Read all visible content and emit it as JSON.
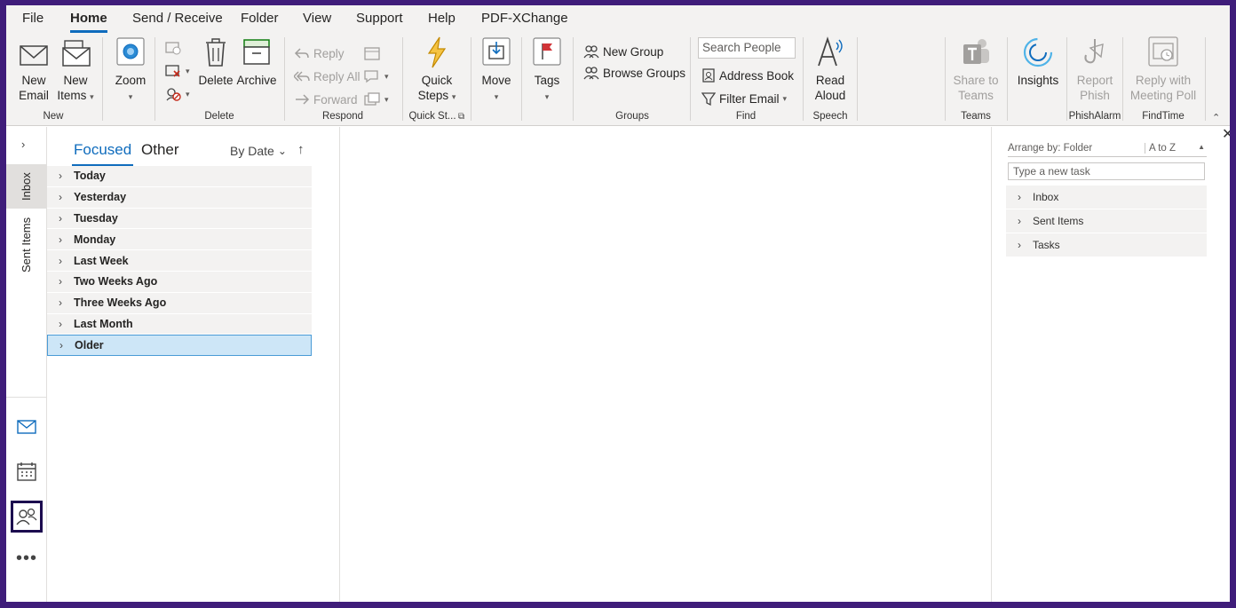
{
  "menu": [
    "File",
    "Home",
    "Send / Receive",
    "Folder",
    "View",
    "Support",
    "Help",
    "PDF-XChange"
  ],
  "active_menu": "Home",
  "ribbon": {
    "new_email": [
      "New",
      "Email"
    ],
    "new_items": [
      "New",
      "Items"
    ],
    "zoom": "Zoom",
    "delete": "Delete",
    "archive": "Archive",
    "reply": "Reply",
    "reply_all": "Reply All",
    "forward": "Forward",
    "quick_steps": [
      "Quick",
      "Steps"
    ],
    "move": "Move",
    "tags": "Tags",
    "new_group": "New Group",
    "browse_groups": "Browse Groups",
    "search_people": "Search People",
    "address_book": "Address Book",
    "filter_email": "Filter Email",
    "read_aloud": [
      "Read",
      "Aloud"
    ],
    "share_to_teams": [
      "Share to",
      "Teams"
    ],
    "insights": "Insights",
    "report_phish": [
      "Report",
      "Phish"
    ],
    "reply_with_poll": [
      "Reply with",
      "Meeting Poll"
    ],
    "groups": {
      "new": "New",
      "delete": "Delete",
      "respond": "Respond",
      "quick_steps": "Quick St...",
      "groups": "Groups",
      "find": "Find",
      "speech": "Speech",
      "teams": "Teams",
      "phishalarm": "PhishAlarm",
      "findtime": "FindTime"
    }
  },
  "rail": {
    "tabs": [
      "Inbox",
      "Sent Items"
    ]
  },
  "list": {
    "tab_focused": "Focused",
    "tab_other": "Other",
    "sort": "By Date",
    "groups": [
      "Today",
      "Yesterday",
      "Tuesday",
      "Monday",
      "Last Week",
      "Two Weeks Ago",
      "Three Weeks Ago",
      "Last Month",
      "Older"
    ],
    "selected": "Older"
  },
  "todo": {
    "arrange_by": "Arrange by: Folder",
    "order": "A to Z",
    "new_task_placeholder": "Type a new task",
    "folders": [
      "Inbox",
      "Sent Items",
      "Tasks"
    ]
  },
  "colors": {
    "accent": "#0f6cbd",
    "frame": "#3f1d7a",
    "selection": "#cde6f7"
  }
}
